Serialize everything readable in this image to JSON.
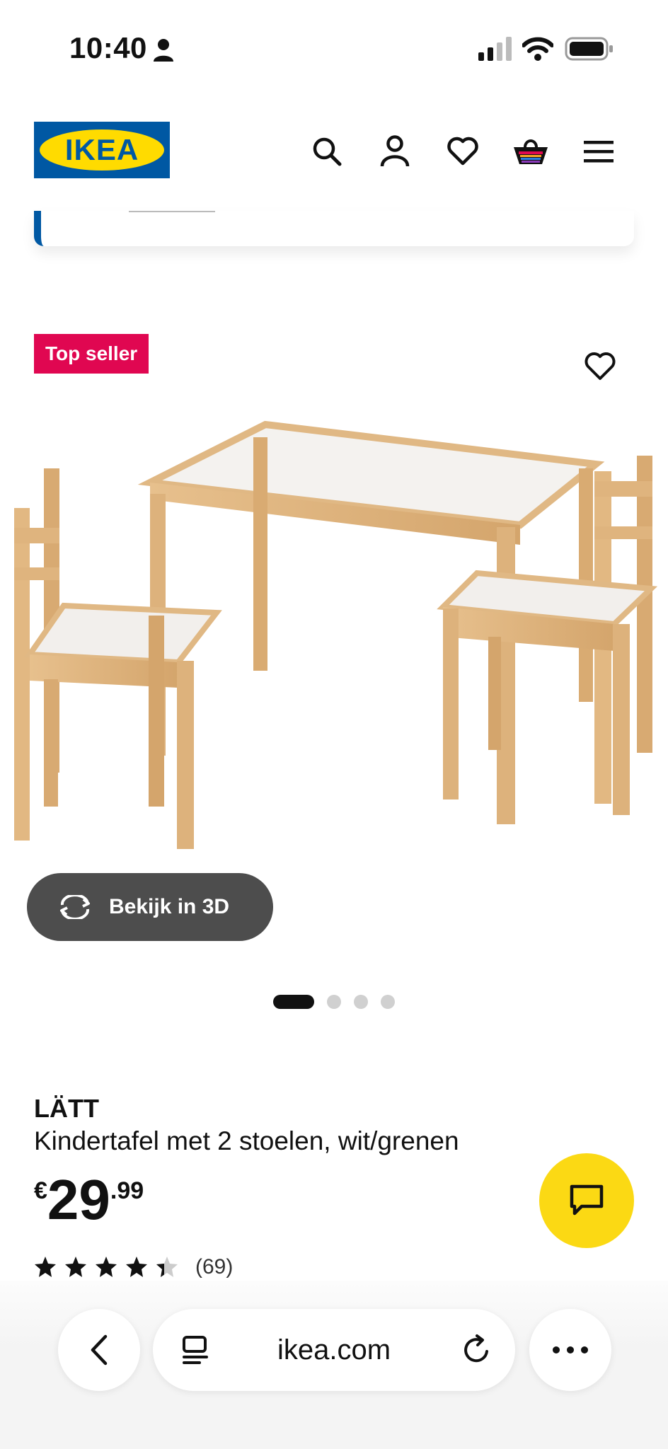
{
  "status_bar": {
    "time": "10:40"
  },
  "header": {
    "logo_text": "IKEA",
    "icons": [
      "search-icon",
      "account-icon",
      "heart-icon",
      "cart-icon",
      "menu-icon"
    ]
  },
  "product": {
    "badge": "Top seller",
    "view_3d_label": "Bekijk in 3D",
    "image_count": 4,
    "active_image": 1,
    "name": "LÄTT",
    "description": "Kindertafel met 2 stoelen, wit/grenen",
    "price_currency": "€",
    "price_integer": "29",
    "price_decimal": ".99",
    "rating": 4.5,
    "rating_count": "(69)"
  },
  "browser": {
    "url": "ikea.com"
  },
  "colors": {
    "ikea_blue": "#0058a3",
    "ikea_yellow": "#ffdb00",
    "badge_red": "#e00751",
    "chat_yellow": "#fbd914"
  }
}
